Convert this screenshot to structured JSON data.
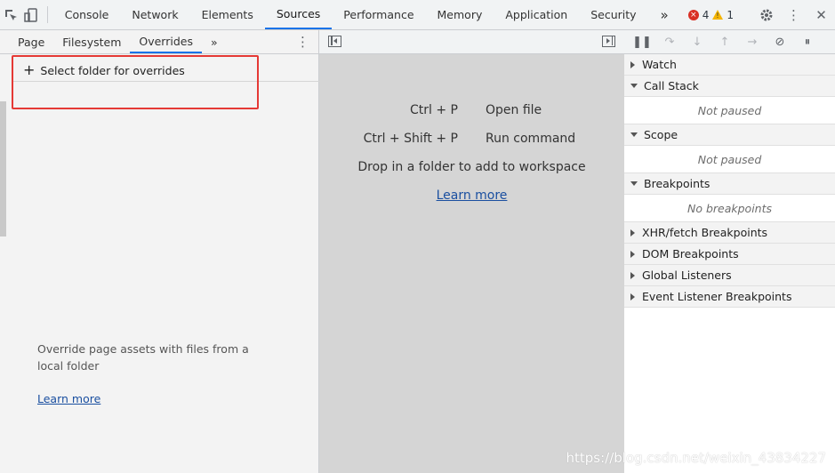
{
  "toolbar": {
    "inspect_icon": "inspect-element-icon",
    "device_icon": "device-toggle-icon",
    "tabs": [
      {
        "label": "Console"
      },
      {
        "label": "Network"
      },
      {
        "label": "Elements"
      },
      {
        "label": "Sources"
      },
      {
        "label": "Performance"
      },
      {
        "label": "Memory"
      },
      {
        "label": "Application"
      },
      {
        "label": "Security"
      }
    ],
    "active_tab": "Sources",
    "more_tabs_glyph": "»",
    "error_count": "4",
    "warning_count": "1",
    "settings_icon": "gear-icon",
    "menu_icon": "kebab-icon",
    "close_icon": "close-icon"
  },
  "navigator": {
    "tabs": [
      {
        "label": "Page"
      },
      {
        "label": "Filesystem"
      },
      {
        "label": "Overrides"
      }
    ],
    "active_tab": "Overrides",
    "more_glyph": "»",
    "select_folder_label": "Select folder for overrides",
    "message": "Override page assets with files from a local folder",
    "learn_more": "Learn more"
  },
  "editor": {
    "shortcuts": [
      {
        "keys": "Ctrl + P",
        "description": "Open file"
      },
      {
        "keys": "Ctrl + Shift + P",
        "description": "Run command"
      }
    ],
    "drop_hint": "Drop in a folder to add to workspace",
    "learn_more": "Learn more"
  },
  "debugger": {
    "sections": [
      {
        "label": "Watch",
        "expanded": false,
        "empty": ""
      },
      {
        "label": "Call Stack",
        "expanded": true,
        "empty": "Not paused"
      },
      {
        "label": "Scope",
        "expanded": true,
        "empty": "Not paused"
      },
      {
        "label": "Breakpoints",
        "expanded": true,
        "empty": "No breakpoints"
      },
      {
        "label": "XHR/fetch Breakpoints",
        "expanded": false,
        "empty": ""
      },
      {
        "label": "DOM Breakpoints",
        "expanded": false,
        "empty": ""
      },
      {
        "label": "Global Listeners",
        "expanded": false,
        "empty": ""
      },
      {
        "label": "Event Listener Breakpoints",
        "expanded": false,
        "empty": ""
      }
    ]
  },
  "watermark": "https://blog.csdn.net/weixin_43834227",
  "colors": {
    "accent": "#1a73e8",
    "highlight_box": "#e53935",
    "error": "#d93025",
    "warning": "#f4b400"
  }
}
